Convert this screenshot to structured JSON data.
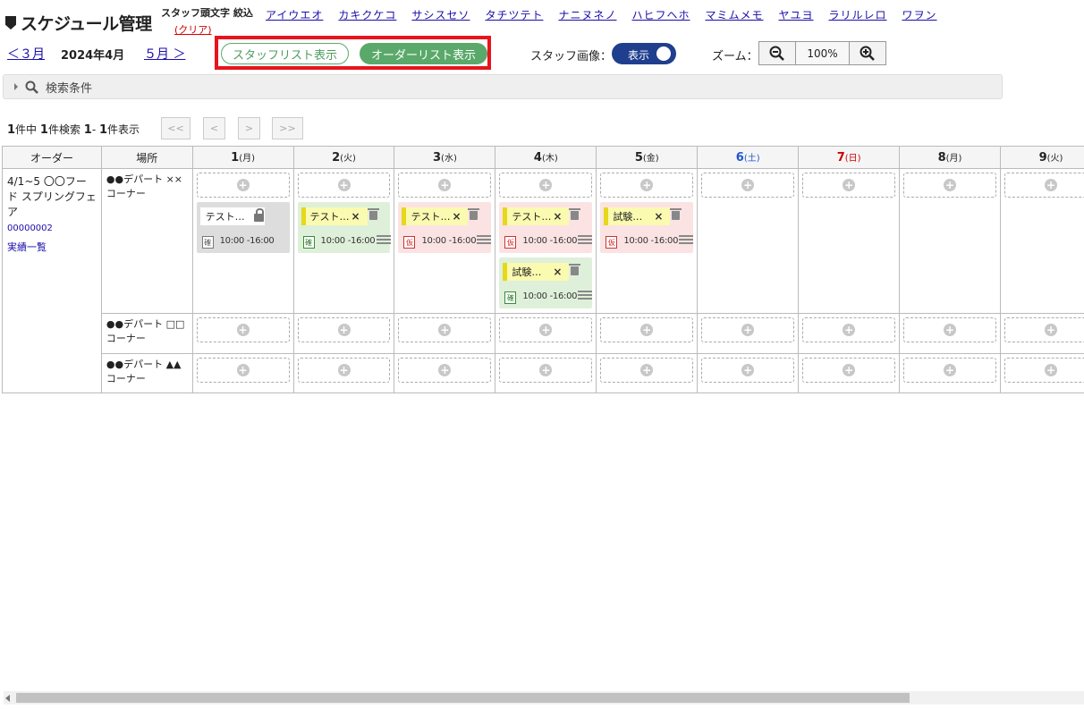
{
  "header": {
    "title": "スケジュール管理",
    "kana_label": "スタッフ頭文字 絞込",
    "kana_clear": "(クリア)",
    "kana_links": [
      "アイウエオ",
      "カキクケコ",
      "サシスセソ",
      "タチツテト",
      "ナニヌネノ",
      "ハヒフヘホ",
      "マミムメモ",
      "ヤユヨ",
      "ラリルレロ",
      "ワヲン"
    ]
  },
  "month_nav": {
    "prev": "＜３月",
    "current": "2024年4月",
    "next": "５月 ＞"
  },
  "view_buttons": {
    "staff": "スタッフリスト表示",
    "order": "オーダーリスト表示"
  },
  "staff_image": {
    "label": "スタッフ画像：",
    "toggle": "表示"
  },
  "zoom": {
    "label": "ズーム：",
    "value": "100%"
  },
  "search": {
    "label": "検索条件"
  },
  "pagination": {
    "total": "1",
    "total_suffix": "件中",
    "found": "1",
    "found_suffix": "件検索",
    "from": "1",
    "dash": "-",
    "to": "1",
    "to_suffix": "件表示",
    "buttons": [
      "<<",
      "<",
      ">",
      ">>"
    ]
  },
  "grid": {
    "col_order": "オーダー",
    "col_place": "場所",
    "days": [
      {
        "num": "1",
        "dow": "(月)",
        "type": "weekday"
      },
      {
        "num": "2",
        "dow": "(火)",
        "type": "weekday"
      },
      {
        "num": "3",
        "dow": "(水)",
        "type": "weekday"
      },
      {
        "num": "4",
        "dow": "(木)",
        "type": "weekday"
      },
      {
        "num": "5",
        "dow": "(金)",
        "type": "weekday"
      },
      {
        "num": "6",
        "dow": "(土)",
        "type": "sat"
      },
      {
        "num": "7",
        "dow": "(日)",
        "type": "sun"
      },
      {
        "num": "8",
        "dow": "(月)",
        "type": "weekday"
      },
      {
        "num": "9",
        "dow": "(火)",
        "type": "weekday"
      }
    ],
    "order": {
      "name": "4/1~5 〇〇フード スプリングフェア",
      "code": "00000002",
      "link": "実績一覧"
    },
    "places": [
      "●●デパート ××コーナー",
      "●●デパート □□コーナー",
      "●●デパート ▲▲コーナー"
    ],
    "cards": {
      "d1": [
        {
          "name": "テスト…",
          "badge": "確",
          "time": "10:00 -16:00",
          "style": "gray",
          "locked": true
        }
      ],
      "d2": [
        {
          "name": "テスト…",
          "badge": "確",
          "time": "10:00 -16:00",
          "style": "green"
        }
      ],
      "d3": [
        {
          "name": "テスト…",
          "badge": "仮",
          "time": "10:00 -16:00",
          "style": "pink"
        }
      ],
      "d4a": [
        {
          "name": "テスト…",
          "badge": "仮",
          "time": "10:00 -16:00",
          "style": "pink"
        }
      ],
      "d4b": [
        {
          "name": "試験…",
          "badge": "確",
          "time": "10:00 -16:00",
          "style": "green"
        }
      ],
      "d5": [
        {
          "name": "試験…",
          "badge": "仮",
          "time": "10:00 -16:00",
          "style": "pink"
        }
      ]
    },
    "add_icon": "+",
    "close_icon": "×"
  },
  "colors": {
    "accent_green": "#5aa96a",
    "toggle_blue": "#1f3f8e",
    "highlight_red": "#e8141c"
  }
}
